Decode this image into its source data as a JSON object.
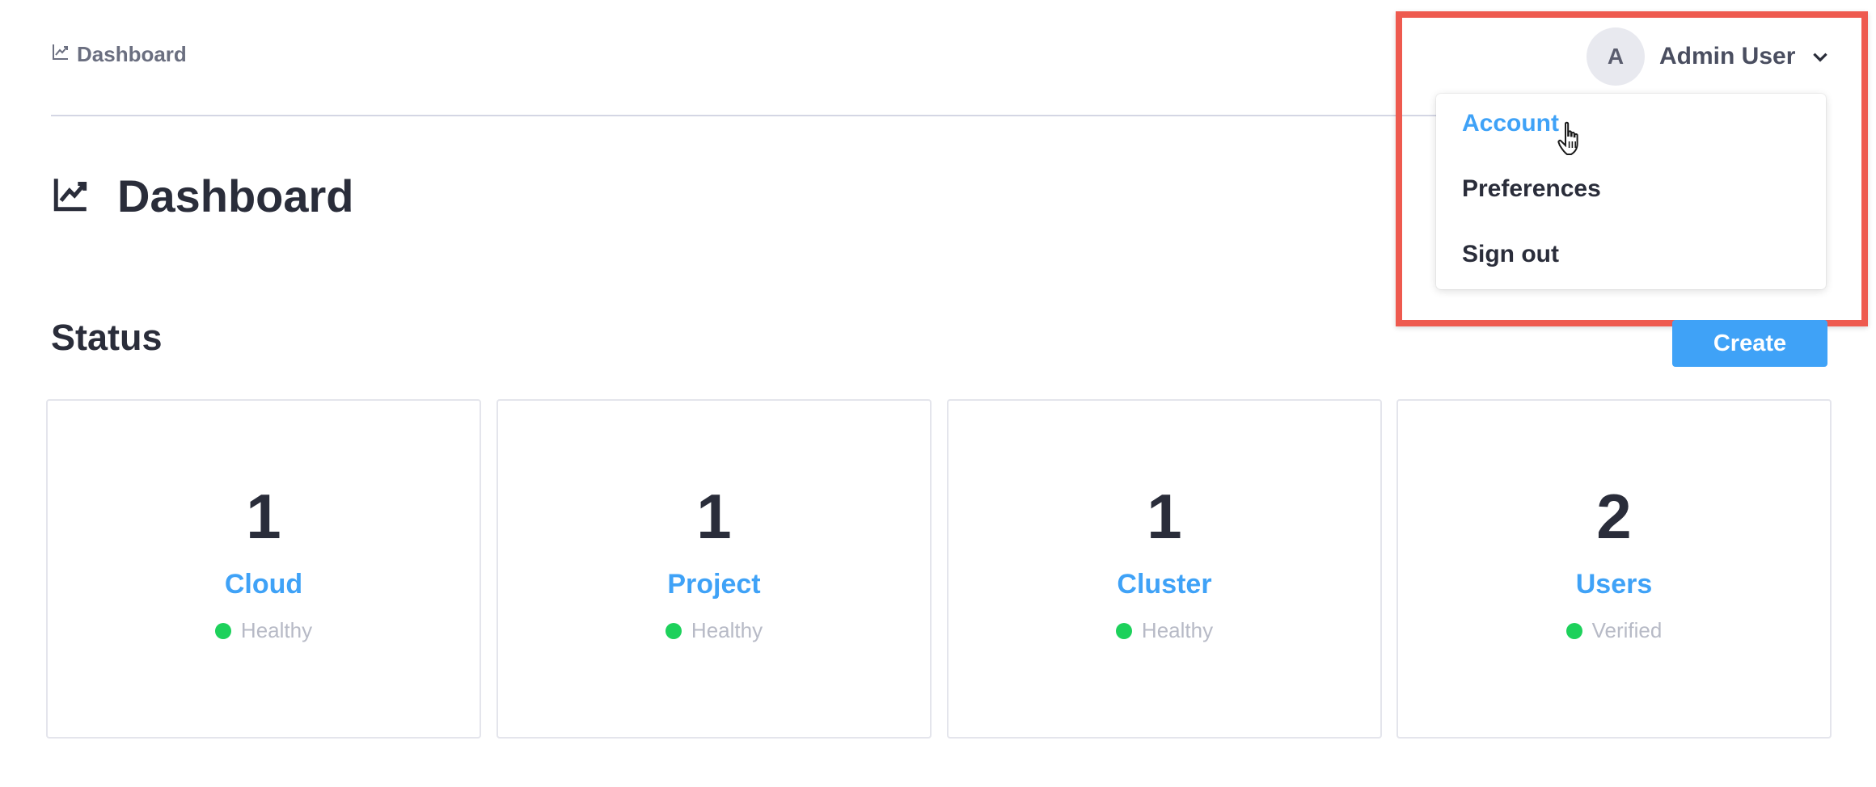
{
  "breadcrumb": {
    "icon": "chart-line-icon",
    "label": "Dashboard"
  },
  "user_menu": {
    "avatar_initial": "A",
    "name": "Admin User",
    "icon": "chevron-down-icon",
    "items": [
      {
        "label": "Account",
        "active": true
      },
      {
        "label": "Preferences",
        "active": false
      },
      {
        "label": "Sign out",
        "active": false
      }
    ]
  },
  "page": {
    "title": "Dashboard",
    "title_icon": "chart-line-icon"
  },
  "status_section": {
    "title": "Status",
    "create_label": "Create"
  },
  "cards": [
    {
      "count": "1",
      "label": "Cloud",
      "status": "Healthy"
    },
    {
      "count": "1",
      "label": "Project",
      "status": "Healthy"
    },
    {
      "count": "1",
      "label": "Cluster",
      "status": "Healthy"
    },
    {
      "count": "2",
      "label": "Users",
      "status": "Verified"
    }
  ],
  "colors": {
    "accent": "#3fa2f7",
    "highlight": "#ee5a4f",
    "status_ok": "#1dd15b",
    "text": "#2a2d3a"
  }
}
